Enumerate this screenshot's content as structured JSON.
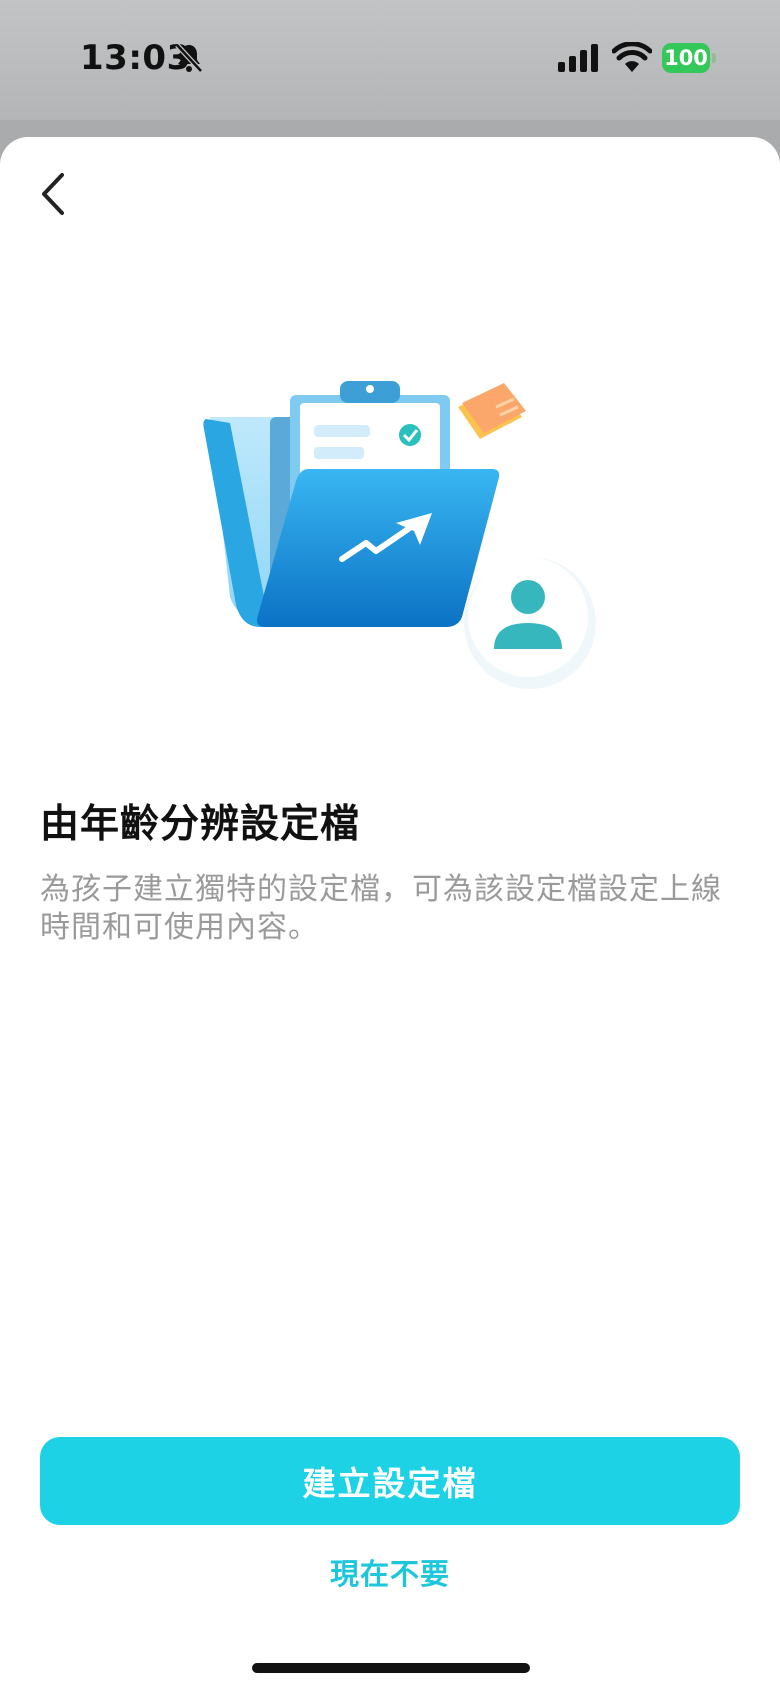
{
  "status": {
    "time": "13:03",
    "battery": "100",
    "icons": [
      "bell-slash-icon",
      "signal-icon",
      "wifi-icon",
      "battery-icon"
    ]
  },
  "nav": {
    "back_icon": "chevron-left-icon"
  },
  "illustration": {
    "icon": "profile-folder-illustration"
  },
  "title": "由年齡分辨設定檔",
  "description": "為孩子建立獨特的設定檔，可為該設定檔設定上線時間和可使用內容。",
  "actions": {
    "primary_label": "建立設定檔",
    "secondary_label": "現在不要"
  },
  "colors": {
    "accent": "#1ed2e6",
    "accent_text": "#1ec6dc",
    "battery": "#34c759"
  }
}
